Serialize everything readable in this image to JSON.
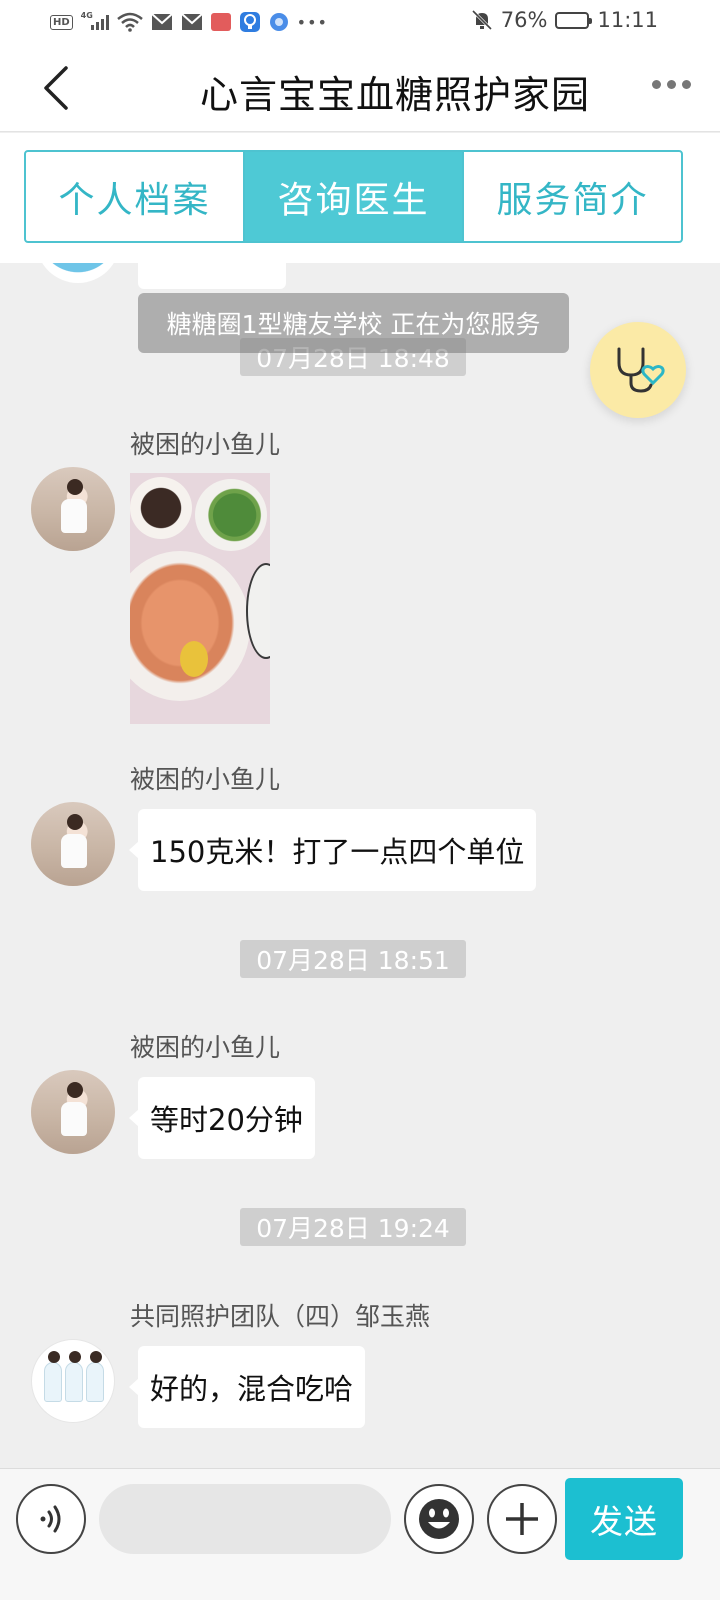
{
  "status_bar": {
    "network_type": "4G",
    "hd_label": "HD",
    "battery_percent": "76%",
    "battery_level": 0.76,
    "time": "11:11",
    "icons": [
      "hd-icon",
      "signal-icon",
      "wifi-icon",
      "mail-icon",
      "mail-icon",
      "app-icon",
      "bulb-icon",
      "browser-icon",
      "more-dots-icon",
      "mute-icon",
      "battery-icon"
    ]
  },
  "header": {
    "title": "心言宝宝血糖照护家园",
    "back_icon": "chevron-left-icon",
    "more_icon": "more-dots-icon"
  },
  "tabs": [
    {
      "label": "个人档案",
      "active": false
    },
    {
      "label": "咨询医生",
      "active": true
    },
    {
      "label": "服务简介",
      "active": false
    }
  ],
  "chat": {
    "service_notice": "糖糖圈1型糖友学校 正在为您服务",
    "partial_timestamp": "07月28日 18:48",
    "messages": [
      {
        "sender": "被困的小鱼儿",
        "type": "image",
        "image_desc": "food-photo"
      },
      {
        "sender": "被困的小鱼儿",
        "type": "text",
        "text": "150克米！打了一点四个单位"
      },
      {
        "timestamp": "07月28日 18:51"
      },
      {
        "sender": "被困的小鱼儿",
        "type": "text",
        "text": "等时20分钟"
      },
      {
        "timestamp": "07月28日 19:24"
      },
      {
        "sender": "共同照护团队（四）邹玉燕",
        "type": "text",
        "text": "好的，混合吃哈"
      }
    ]
  },
  "fab": {
    "icon": "stethoscope-heart-icon",
    "color": "#fbeaa6"
  },
  "input_bar": {
    "voice_icon": "voice-icon",
    "input_value": "",
    "emoji_icon": "emoji-icon",
    "plus_icon": "plus-icon",
    "send_label": "发送"
  },
  "colors": {
    "accent": "#4ec9d5",
    "send": "#1cbfd1",
    "chat_bg": "#efefef",
    "timestamp_bg": "#cfcfcf"
  }
}
